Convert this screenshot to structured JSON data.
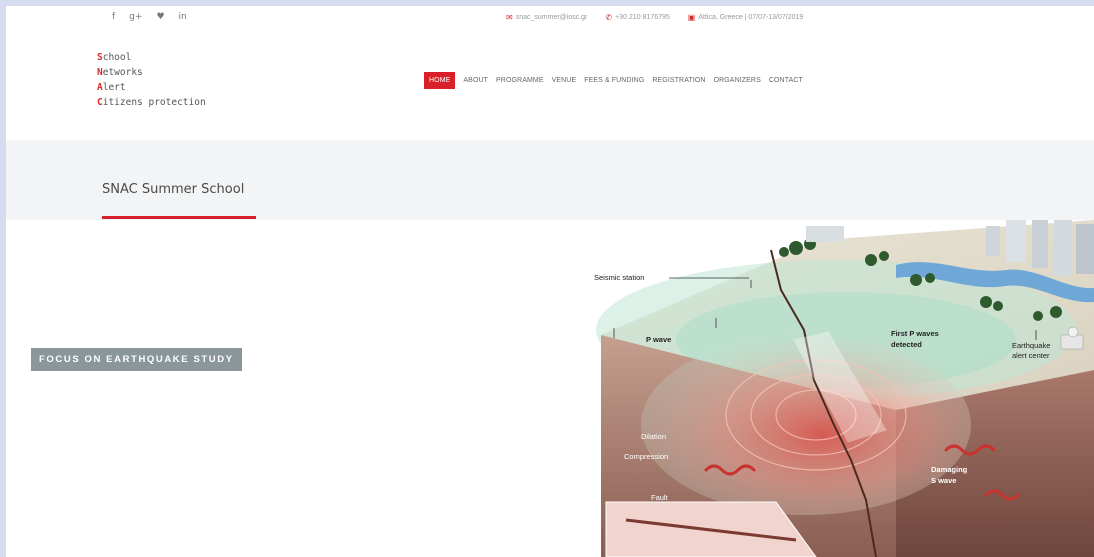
{
  "social": {
    "facebook": "f",
    "googleplus": "g+",
    "twitter": "♥",
    "linkedin": "in"
  },
  "contact": {
    "email": "snac_summer@iosc.gr",
    "phone": "+30 210 8176795",
    "event": "Attica, Greece | 07/07-13/07/2019"
  },
  "logo": {
    "lines": [
      {
        "initial": "S",
        "rest": "chool"
      },
      {
        "initial": "N",
        "rest": "etworks"
      },
      {
        "initial": "A",
        "rest": "lert"
      },
      {
        "initial": "C",
        "rest": "itizens protection"
      }
    ]
  },
  "nav": {
    "items": [
      "HOME",
      "ABOUT",
      "PROGRAMME",
      "VENUE",
      "FEES & FUNDING",
      "REGISTRATION",
      "ORGANIZERS",
      "CONTACT"
    ],
    "active": "HOME"
  },
  "page": {
    "title": "SNAC Summer School"
  },
  "hero": {
    "tagline": "FOCUS ON EARTHQUAKE STUDY",
    "labels": {
      "seismic_station": "Seismic station",
      "p_wave": "P wave",
      "first_p": "First P waves",
      "detected": "detected",
      "alert1": "Earthquake",
      "alert2": "alert center",
      "dilation": "Dilation",
      "compression": "Compression",
      "damaging": "Damaging",
      "s_wave": "S wave",
      "fault": "Fault"
    }
  },
  "colors": {
    "accent": "#d9202a",
    "tagline_bg": "#8a969a"
  }
}
